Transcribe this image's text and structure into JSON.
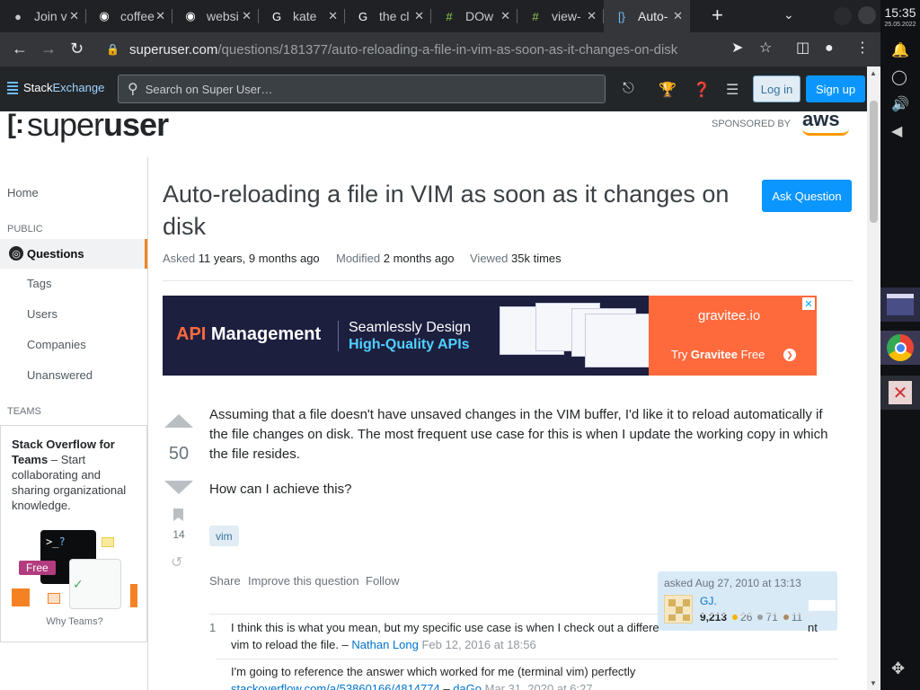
{
  "browser": {
    "tabs": [
      {
        "title": "Join v",
        "icon": "wifi-tab-icon",
        "glyph": "●",
        "color": "#c6c9cc"
      },
      {
        "title": "coffee",
        "icon": "github-icon",
        "glyph": "◉",
        "color": "#ffffff"
      },
      {
        "title": "websi",
        "icon": "github-icon",
        "glyph": "◉",
        "color": "#ffffff"
      },
      {
        "title": "kate",
        "icon": "google-icon",
        "glyph": "G",
        "color": "#ffffff"
      },
      {
        "title": "the cl",
        "icon": "google-icon",
        "glyph": "G",
        "color": "#ffffff"
      },
      {
        "title": "DOw",
        "icon": "hashtag-icon",
        "glyph": "#",
        "color": "#8fd14f"
      },
      {
        "title": "view-",
        "icon": "hashtag-icon",
        "glyph": "#",
        "color": "#8fd14f"
      },
      {
        "title": "Auto-",
        "icon": "superuser-icon",
        "glyph": "[}",
        "color": "#6cbbf7",
        "active": true
      }
    ],
    "new_tab_label": "+",
    "url_host": "superuser.com",
    "url_path": "/questions/181377/auto-reloading-a-file-in-vim-as-soon-as-it-changes-on-disk"
  },
  "system": {
    "time": "15:35",
    "date": "25.05.2022"
  },
  "stackexchange": {
    "brand_a": "Stack",
    "brand_b": "Exchange",
    "search_placeholder": "Search on Super User…",
    "login_label": "Log in",
    "signup_label": "Sign up"
  },
  "site": {
    "logo_a": "super",
    "logo_b": "user",
    "sponsored_by": "SPONSORED BY",
    "sponsor_name": "aws"
  },
  "sidebar": {
    "home": "Home",
    "public_heading": "PUBLIC",
    "questions": "Questions",
    "tags": "Tags",
    "users": "Users",
    "companies": "Companies",
    "unanswered": "Unanswered",
    "teams_heading": "TEAMS",
    "teams_bold": "Stack Overflow for Teams",
    "teams_text": " – Start collaborating and sharing organizational knowledge.",
    "free_badge": "Free",
    "why_teams": "Why Teams?"
  },
  "question": {
    "title": "Auto-reloading a file in VIM as soon as it changes on disk",
    "ask_button": "Ask Question",
    "asked_label": "Asked",
    "asked_value": "11 years, 9 months ago",
    "modified_label": "Modified",
    "modified_value": "2 months ago",
    "viewed_label": "Viewed",
    "viewed_value": "35k times",
    "votes": "50",
    "bookmarks": "14",
    "body_p1": "Assuming that a file doesn't have unsaved changes in the VIM buffer, I'd like it to reload automatically if the file changes on disk. The most frequent use case for this is when I update the working copy in which the file resides.",
    "body_p2": "How can I achieve this?",
    "tag": "vim",
    "share": "Share",
    "improve": "Improve this question",
    "follow": "Follow"
  },
  "ad": {
    "headline_a": "API",
    "headline_b": " Management",
    "tagline_1": "Seamlessly Design",
    "tagline_2": "High-Quality APIs",
    "brand": "gravitee.io",
    "cta_a": "Try ",
    "cta_b": "Gravitee",
    "cta_c": " Free",
    "close": "✕"
  },
  "owner": {
    "asked": "asked Aug 27, 2010 at 13:13",
    "name": "GJ.",
    "reputation": "9,213",
    "gold": "26",
    "silver": "71",
    "bronze": "11"
  },
  "comments": [
    {
      "score": "1",
      "text": "I think this is what you mean, but my specific use case is when I check out a differe",
      "text_tail": "nt",
      "text2": "vim to reload the file. – ",
      "author": "Nathan Long",
      "time": "Feb 12, 2016 at 18:56"
    },
    {
      "score": "",
      "text": "I'm going to reference the answer which worked for me (terminal vim) perfectly",
      "link": "stackoverflow.com/a/53860166/4814774",
      "dash": " – ",
      "author": "daGo",
      "time": "Mar 31, 2020 at 6:27"
    }
  ],
  "colors": {
    "accent_blue": "#0a95ff",
    "sidebar_active_border": "#f48225",
    "ad_orange": "#ff6a3d",
    "ad_navy": "#1d1f3f"
  }
}
